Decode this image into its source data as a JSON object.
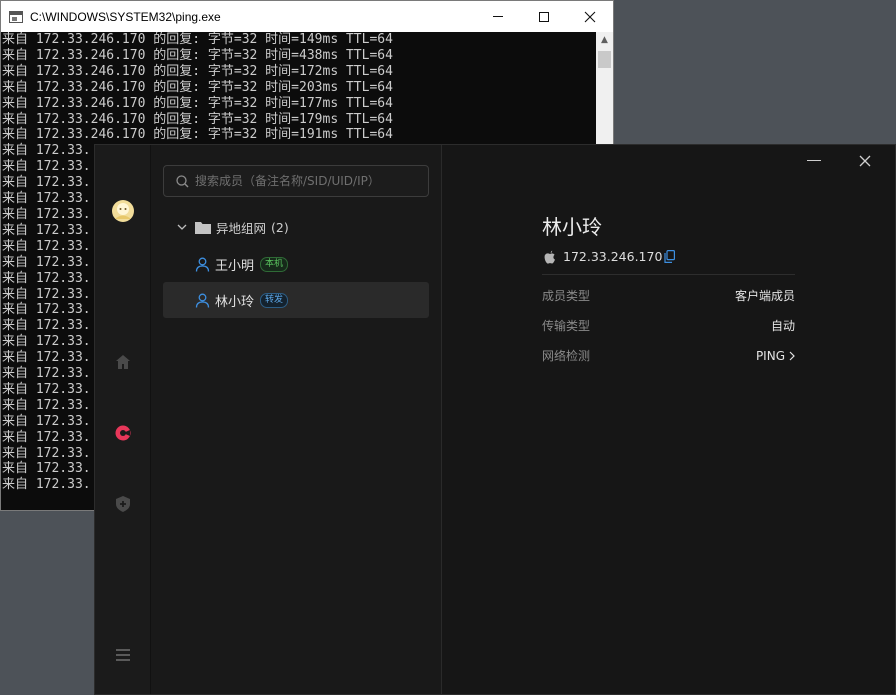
{
  "console": {
    "title": "C:\\WINDOWS\\SYSTEM32\\ping.exe",
    "lines": [
      "来自 172.33.246.170 的回复: 字节=32 时间=149ms TTL=64",
      "来自 172.33.246.170 的回复: 字节=32 时间=438ms TTL=64",
      "来自 172.33.246.170 的回复: 字节=32 时间=172ms TTL=64",
      "来自 172.33.246.170 的回复: 字节=32 时间=203ms TTL=64",
      "来自 172.33.246.170 的回复: 字节=32 时间=177ms TTL=64",
      "来自 172.33.246.170 的回复: 字节=32 时间=179ms TTL=64",
      "来自 172.33.246.170 的回复: 字节=32 时间=191ms TTL=64",
      "来自 172.33.",
      "来自 172.33.",
      "来自 172.33.",
      "来自 172.33.",
      "来自 172.33.",
      "来自 172.33.",
      "来自 172.33.",
      "来自 172.33.",
      "来自 172.33.",
      "来自 172.33.",
      "来自 172.33.",
      "来自 172.33.",
      "来自 172.33.",
      "来自 172.33.",
      "来自 172.33.",
      "来自 172.33.",
      "来自 172.33.",
      "来自 172.33.",
      "来自 172.33.",
      "来自 172.33.",
      "来自 172.33.",
      "来自 172.33."
    ]
  },
  "app": {
    "search": {
      "placeholder": "搜索成员（备注名称/SID/UID/IP）"
    },
    "group": {
      "name": "异地组网",
      "count": "(2)"
    },
    "members": [
      {
        "name": "王小明",
        "badge": "本机",
        "badge_type": "local"
      },
      {
        "name": "林小玲",
        "badge": "转发",
        "badge_type": "relay"
      }
    ],
    "detail": {
      "name": "林小玲",
      "os_icon": "apple-icon",
      "ip": "172.33.246.170",
      "rows": [
        {
          "key": "成员类型",
          "value": "客户端成员"
        },
        {
          "key": "传输类型",
          "value": "自动"
        },
        {
          "key": "网络检测",
          "value": "PING"
        }
      ]
    },
    "colors": {
      "accent_red": "#e8375a",
      "local_green": "#5ac35f",
      "relay_blue": "#5ea7e6"
    }
  }
}
